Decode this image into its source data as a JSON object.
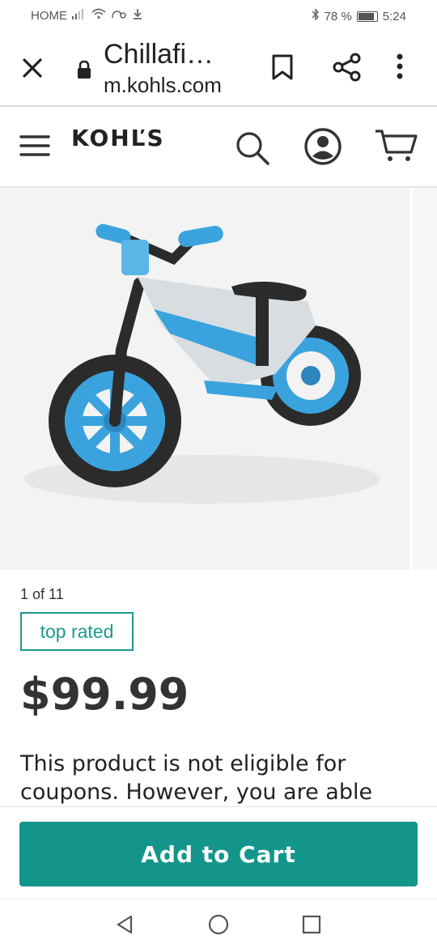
{
  "status_bar": {
    "carrier": "HOME",
    "battery_percent_label": "78 %",
    "battery_level": 0.78,
    "time": "5:24",
    "icons": [
      "signal-icon",
      "wifi-icon",
      "data-icon",
      "download-icon",
      "bluetooth-icon",
      "battery-icon"
    ]
  },
  "browser": {
    "title": "Chillafi…",
    "url": "m.kohls.com"
  },
  "header": {
    "logo_text": "KOHĽS"
  },
  "product": {
    "image_alt": "blue balance bike",
    "image_counter": "1 of 11",
    "badge": "top rated",
    "price": "$99.99",
    "notice": "This product is not eligible for coupons. However, you are able"
  },
  "actions": {
    "add_to_cart": "Add to Cart"
  },
  "colors": {
    "accent": "#13958c",
    "badge": "#1a9a8f",
    "bike_blue": "#3aa3dd",
    "bike_frame": "#d8dde2"
  }
}
